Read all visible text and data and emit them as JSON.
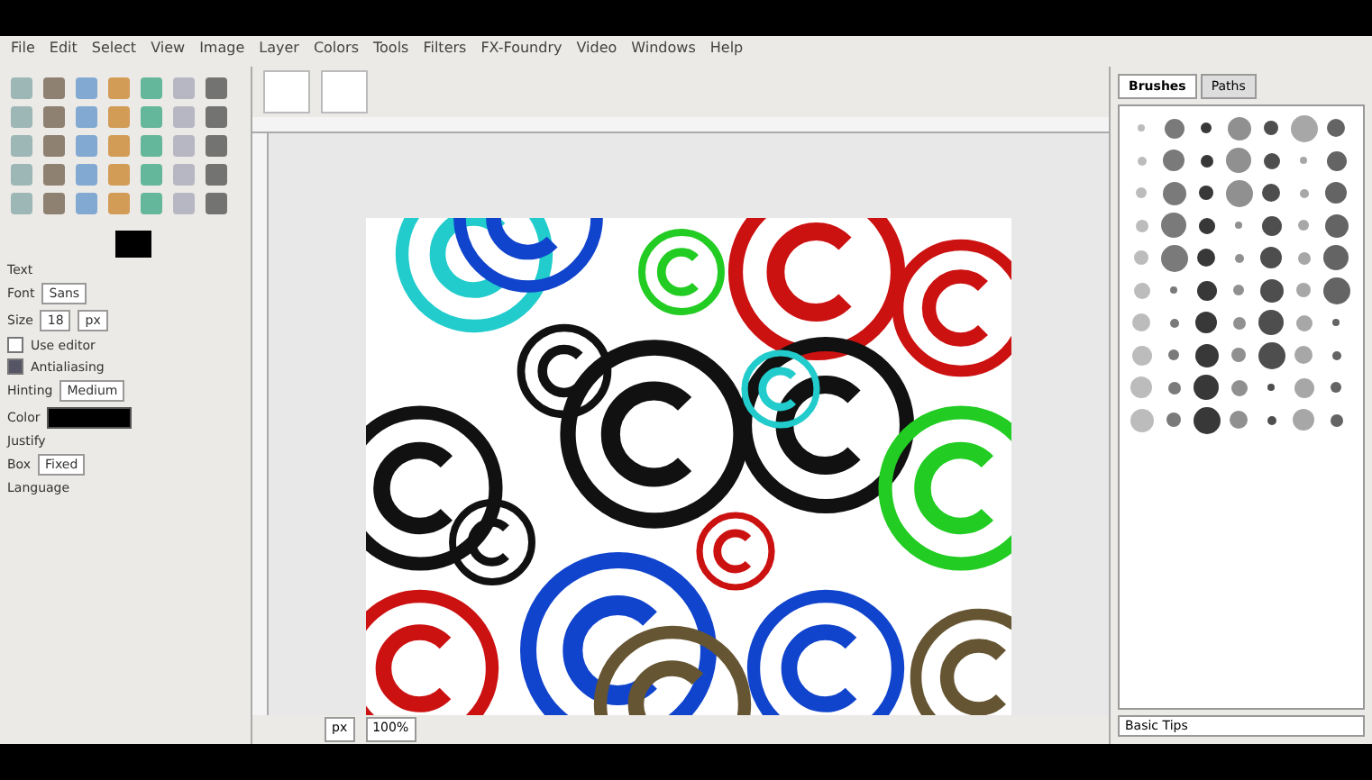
{
  "menu": [
    "File",
    "Edit",
    "Select",
    "View",
    "Image",
    "Layer",
    "Colors",
    "Tools",
    "Filters",
    "FX-Foundry",
    "Video",
    "Windows",
    "Help"
  ],
  "tool_options": {
    "title": "Text",
    "font_label": "Font",
    "font_value": "Sans",
    "size_label": "Size",
    "size_value": "18",
    "size_unit": "px",
    "editor_label": "Use editor",
    "editor_checked": false,
    "antialias_label": "Antialiasing",
    "antialias_checked": true,
    "hinting_label": "Hinting",
    "hinting_value": "Medium",
    "color_label": "Color",
    "justify_label": "Justify",
    "box_label": "Box",
    "box_value": "Fixed",
    "language_label": "Language"
  },
  "dock": {
    "tabs": [
      {
        "label": "Brushes",
        "selected": true
      },
      {
        "label": "Paths",
        "selected": false
      }
    ],
    "filter_label": "Basic Tips"
  },
  "status_bar": {
    "unit": "px",
    "zoom": "100%"
  }
}
